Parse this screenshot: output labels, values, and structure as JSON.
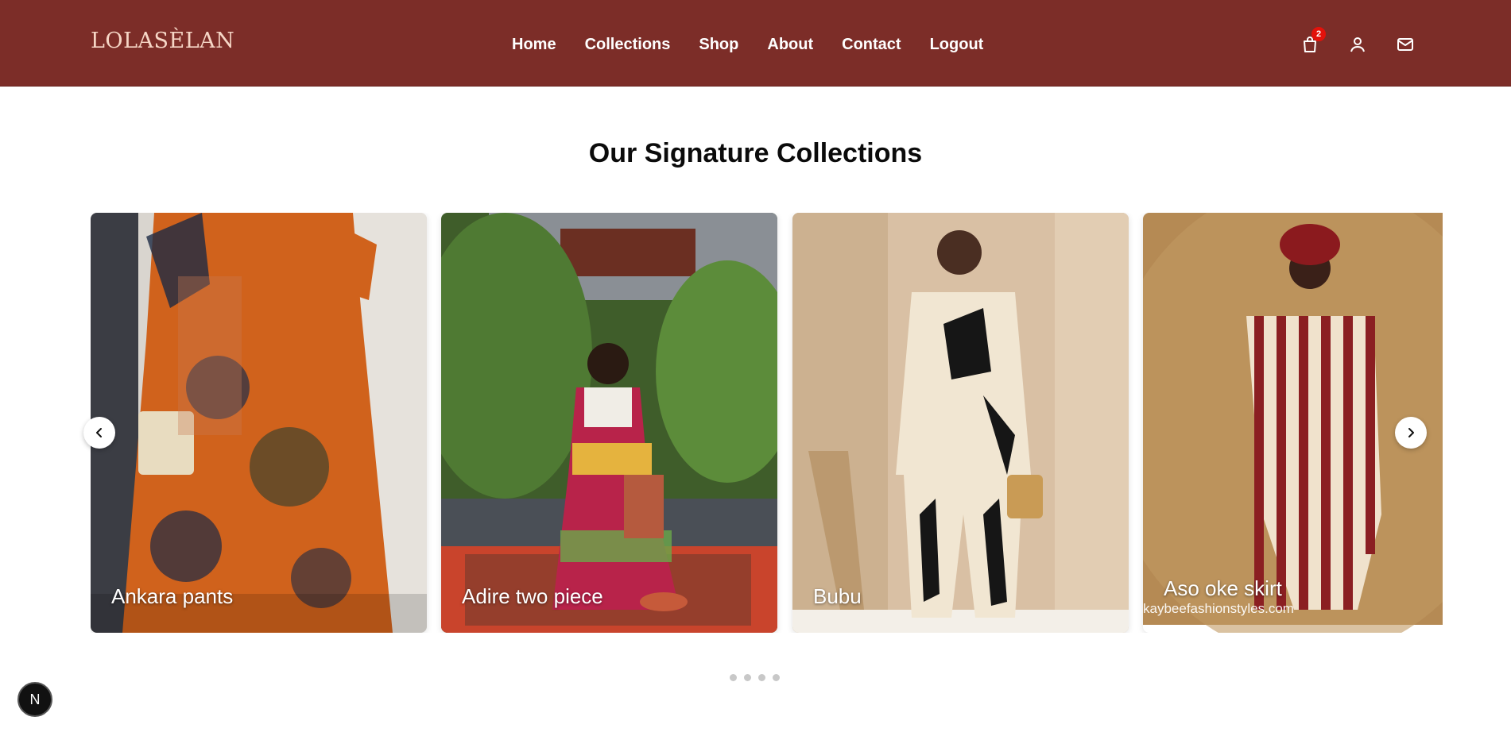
{
  "brand": {
    "logo_text": "LOLASÈLAN",
    "primary_color": "#7c2d28",
    "badge_color": "#e3120b"
  },
  "nav": {
    "items": [
      {
        "label": "Home"
      },
      {
        "label": "Collections"
      },
      {
        "label": "Shop"
      },
      {
        "label": "About"
      },
      {
        "label": "Contact"
      },
      {
        "label": "Logout"
      }
    ]
  },
  "header_icons": {
    "cart_icon": "shopping-bag-icon",
    "cart_count": "2",
    "account_icon": "user-icon",
    "mail_icon": "mail-icon"
  },
  "collections": {
    "title": "Our Signature Collections",
    "cards": [
      {
        "caption": "Ankara pants"
      },
      {
        "caption": "Adire two piece"
      },
      {
        "caption": "Bubu"
      },
      {
        "caption": "Aso oke skirt",
        "watermark": "kaybeefashionstyles.com"
      }
    ],
    "prev_icon": "chevron-left-icon",
    "next_icon": "chevron-right-icon",
    "dots_count": 4
  },
  "dev_badge": {
    "label": "N"
  }
}
